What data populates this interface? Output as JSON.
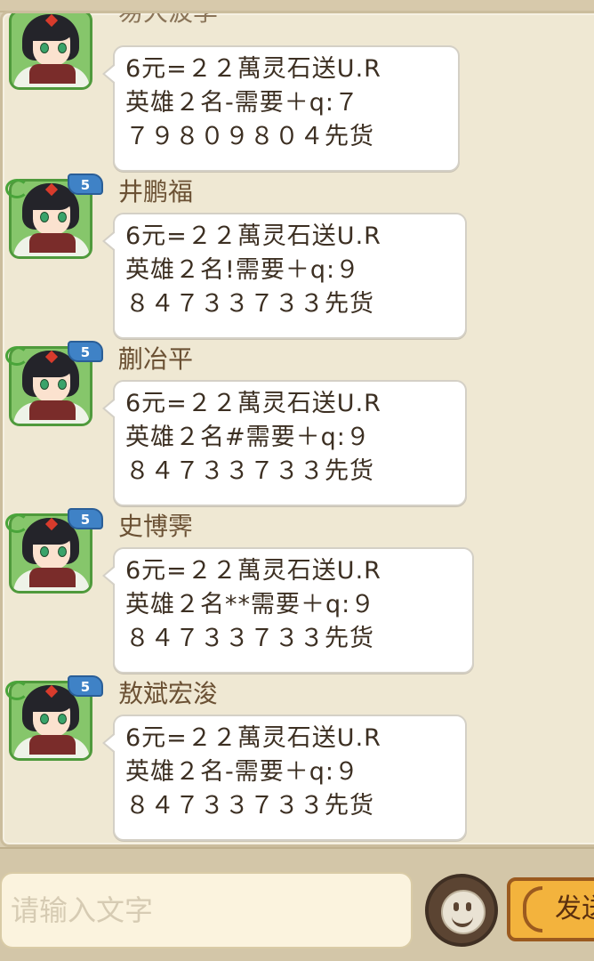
{
  "chat": {
    "top_partial_name": "易大波李",
    "messages": [
      {
        "sender": "",
        "level": "",
        "lines": [
          "6元=２２萬灵石送U.R",
          "英雄２名-需要＋q:７",
          "７９８０９８０４先货"
        ]
      },
      {
        "sender": "井鹏福",
        "level": "5",
        "lines": [
          "6元=２２萬灵石送U.R",
          "英雄２名!需要＋q:９",
          "８４７３３７３３先货"
        ]
      },
      {
        "sender": "蒯冶平",
        "level": "5",
        "lines": [
          "6元=２２萬灵石送U.R",
          "英雄２名#需要＋q:９",
          "８４７３３７３３先货"
        ]
      },
      {
        "sender": "史博霁",
        "level": "5",
        "lines": [
          "6元=２２萬灵石送U.R",
          "英雄２名**需要＋q:９",
          "８４７３３７３３先货"
        ]
      },
      {
        "sender": "敖斌宏浚",
        "level": "5",
        "lines": [
          "6元=２２萬灵石送U.R",
          "英雄２名-需要＋q:９",
          "８４７３３７３３先货"
        ]
      }
    ]
  },
  "input": {
    "placeholder": "请输入文字",
    "value": ""
  },
  "buttons": {
    "emoji_icon": "smiley-face-icon",
    "send_label": "发送"
  },
  "colors": {
    "panel_bg": "#efe8d3",
    "sender_name": "#6b5134",
    "message_text": "#3c2f22",
    "level_badge": "#3f82c6",
    "avatar_frame": "#4f9a3c",
    "send_button": "#f3b33d"
  }
}
